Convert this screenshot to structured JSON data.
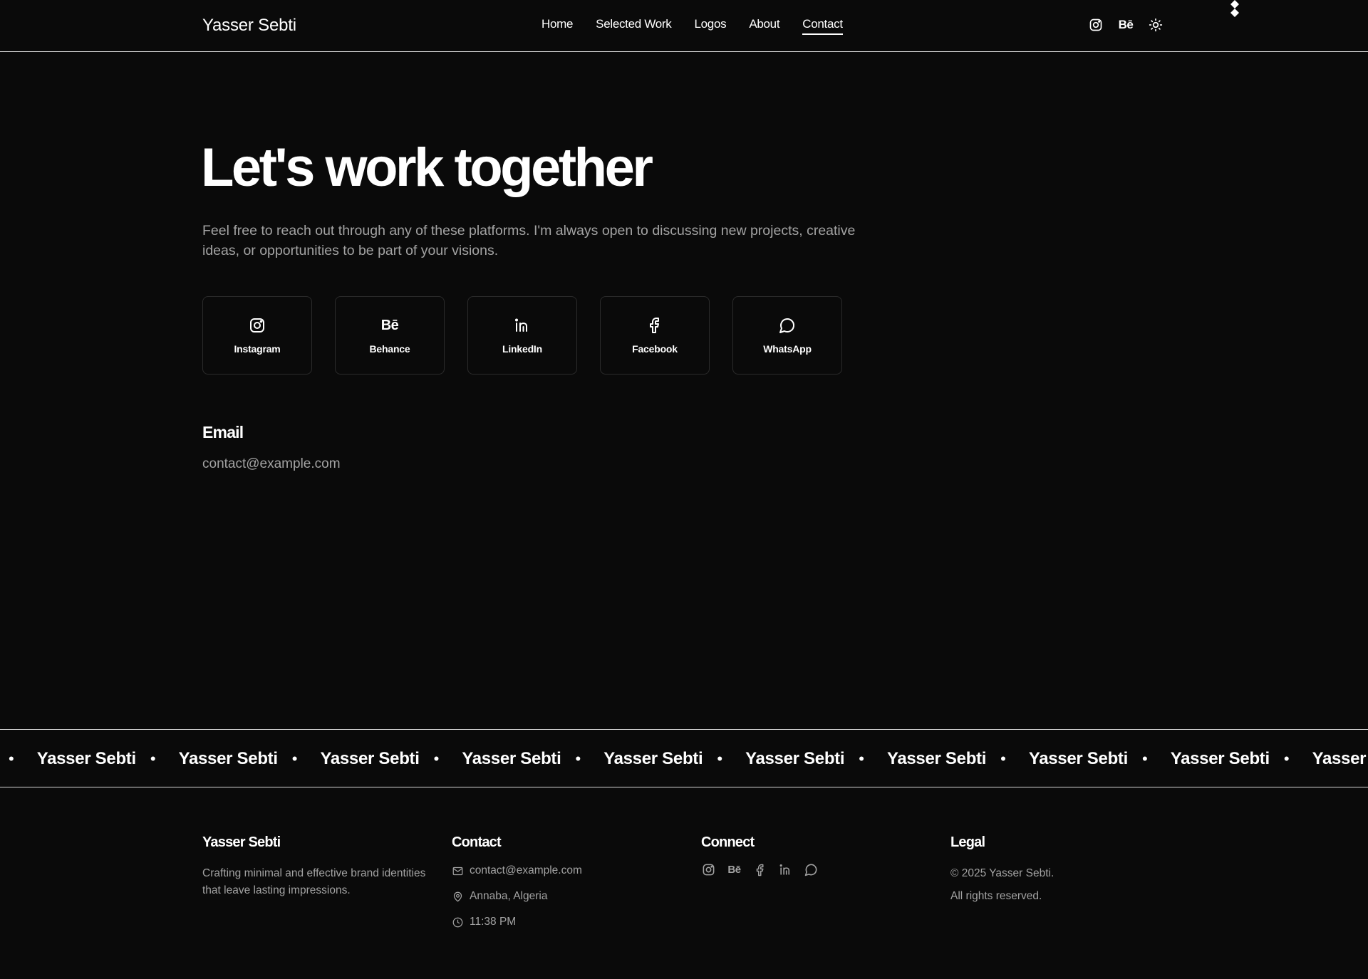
{
  "header": {
    "brand": "Yasser Sebti",
    "nav": [
      "Home",
      "Selected Work",
      "Logos",
      "About",
      "Contact"
    ],
    "active_nav": "Contact",
    "icons": [
      "instagram-icon",
      "behance-icon",
      "sun-icon"
    ]
  },
  "hero": {
    "title": "Let's work together",
    "subtitle": "Feel free to reach out through any of these platforms. I'm always open to discussing new projects, creative ideas, or opportunities to be part of your visions."
  },
  "platforms": [
    {
      "label": "Instagram",
      "icon": "instagram-icon"
    },
    {
      "label": "Behance",
      "icon": "behance-icon"
    },
    {
      "label": "LinkedIn",
      "icon": "linkedin-icon"
    },
    {
      "label": "Facebook",
      "icon": "facebook-icon"
    },
    {
      "label": "WhatsApp",
      "icon": "whatsapp-icon"
    }
  ],
  "email": {
    "heading": "Email",
    "address": "contact@example.com"
  },
  "marquee": {
    "text": "Yasser Sebti",
    "separator": "•"
  },
  "footer": {
    "brand": {
      "heading": "Yasser Sebti",
      "tagline": "Crafting minimal and effective brand identities that leave lasting impressions."
    },
    "contact": {
      "heading": "Contact",
      "email": "contact@example.com",
      "location": "Annaba, Algeria",
      "time": "11:38 PM"
    },
    "connect": {
      "heading": "Connect",
      "icons": [
        "instagram-icon",
        "behance-icon",
        "facebook-icon",
        "linkedin-icon",
        "whatsapp-icon"
      ]
    },
    "legal": {
      "heading": "Legal",
      "copyright": "© 2025 Yasser Sebti.",
      "rights": "All rights reserved."
    }
  },
  "colors": {
    "background": "#0a0a0a",
    "text": "#ffffff",
    "muted": "#a3a3a3",
    "border": "#2b2b2b",
    "divider": "#d6d6d6"
  }
}
